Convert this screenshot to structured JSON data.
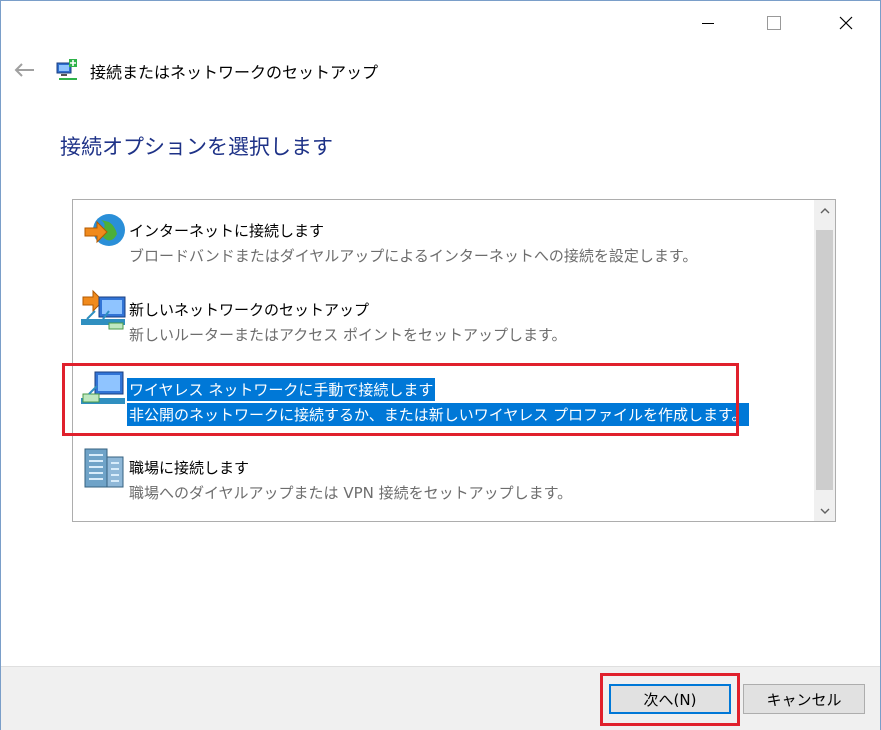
{
  "window": {
    "title": "接続またはネットワークのセットアップ",
    "heading": "接続オプションを選択します"
  },
  "options": [
    {
      "title": "インターネットに接続します",
      "description": "ブロードバンドまたはダイヤルアップによるインターネットへの接続を設定します。",
      "icon": "globe-arrow-icon",
      "selected": false
    },
    {
      "title": "新しいネットワークのセットアップ",
      "description": "新しいルーターまたはアクセス ポイントをセットアップします。",
      "icon": "router-setup-icon",
      "selected": false
    },
    {
      "title": "ワイヤレス ネットワークに手動で接続します",
      "description": "非公開のネットワークに接続するか、または新しいワイヤレス プロファイルを作成します。",
      "icon": "wireless-network-icon",
      "selected": true
    },
    {
      "title": "職場に接続します",
      "description": "職場へのダイヤルアップまたは VPN 接続をセットアップします。",
      "icon": "workplace-vpn-icon",
      "selected": false
    }
  ],
  "buttons": {
    "next_label": "次へ(N)",
    "cancel_label": "キャンセル"
  },
  "colors": {
    "heading": "#1e3287",
    "selection": "#0078d7",
    "highlight": "#e0202c"
  }
}
